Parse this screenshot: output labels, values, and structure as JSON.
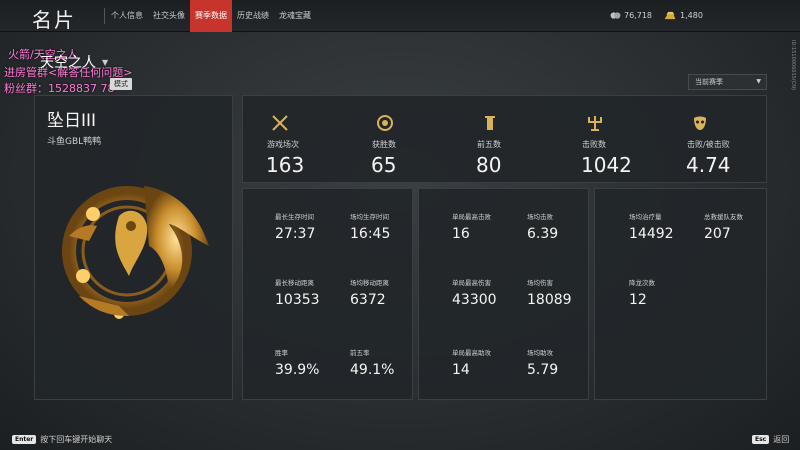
{
  "header": {
    "title": "名片",
    "tabs": [
      {
        "label": "个人信息",
        "active": false
      },
      {
        "label": "社交头像",
        "active": false
      },
      {
        "label": "赛季数据",
        "active": true
      },
      {
        "label": "历史战绩",
        "active": false
      },
      {
        "label": "龙魂宝藏",
        "active": false
      }
    ],
    "currency_a": {
      "icon": "coin-icon",
      "value": "76,718"
    },
    "currency_b": {
      "icon": "gold-bar-icon",
      "value": "1,480"
    }
  },
  "overlay": {
    "line1": "火箭/天空之人",
    "line2": "进房管群<解答任何问题>",
    "line3": "粉丝群：1528837 78"
  },
  "mode": {
    "name": "天空之人",
    "badge": "模式"
  },
  "season_selector": {
    "value": "当前赛季"
  },
  "side_id": "ID:1510006015(CN)",
  "profile": {
    "rank": "坠日III",
    "player": "斗鱼GBL鸭鸭",
    "emblem": "phoenix-emblem-icon"
  },
  "summary": [
    {
      "icon": "crossed-swords-icon",
      "label": "游戏场次",
      "value": "163"
    },
    {
      "icon": "laurel-emblem-icon",
      "label": "获胜数",
      "value": "65"
    },
    {
      "icon": "tower-icon",
      "label": "前五数",
      "value": "80"
    },
    {
      "icon": "trident-icon",
      "label": "击败数",
      "value": "1042"
    },
    {
      "icon": "mask-icon",
      "label": "击败/被击败",
      "value": "4.74"
    }
  ],
  "details": {
    "survival": [
      {
        "label": "最长生存时间",
        "value": "27:37"
      },
      {
        "label": "场均生存时间",
        "value": "16:45"
      },
      {
        "label": "最长移动距离",
        "value": "10353"
      },
      {
        "label": "场均移动距离",
        "value": "6372"
      },
      {
        "label": "胜率",
        "value": "39.9%"
      },
      {
        "label": "前五率",
        "value": "49.1%"
      }
    ],
    "combat": [
      {
        "label": "单局最高击败",
        "value": "16"
      },
      {
        "label": "场均击败",
        "value": "6.39"
      },
      {
        "label": "单局最高伤害",
        "value": "43300"
      },
      {
        "label": "场均伤害",
        "value": "18089"
      },
      {
        "label": "单局最高助攻",
        "value": "14"
      },
      {
        "label": "场均助攻",
        "value": "5.79"
      }
    ],
    "support": [
      {
        "label": "场均治疗量",
        "value": "14492"
      },
      {
        "label": "总救援队友数",
        "value": "207"
      },
      {
        "label": "降龙次数",
        "value": "12"
      }
    ]
  },
  "footer": {
    "chat_key": "Enter",
    "chat_text": "按下回车键开始聊天",
    "back_key": "Esc",
    "back_text": "返回"
  },
  "colors": {
    "accent": "#c7342d",
    "gold": "#c9a24a"
  }
}
